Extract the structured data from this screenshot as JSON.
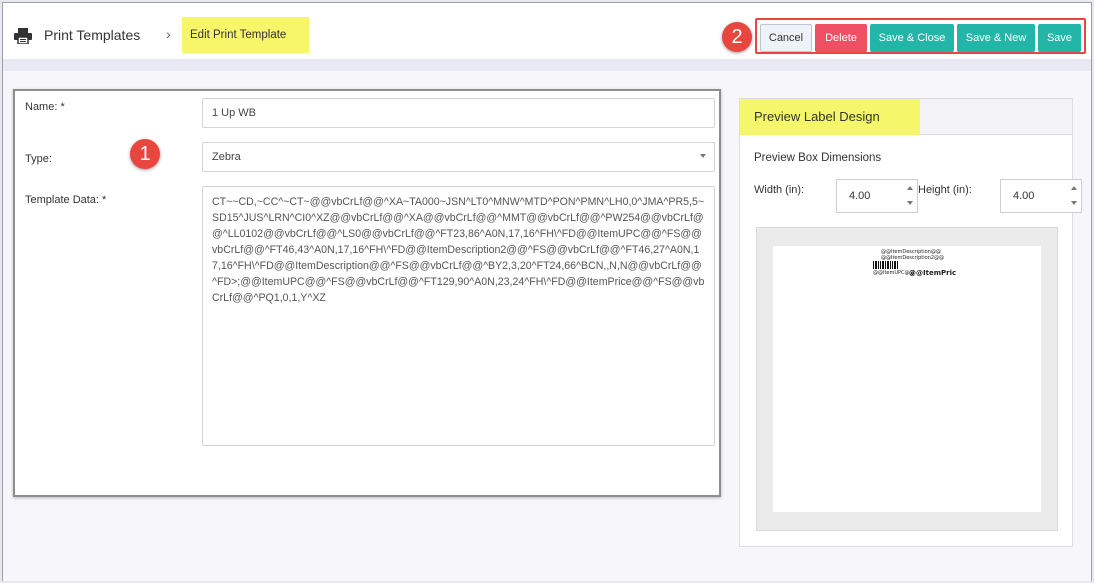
{
  "header": {
    "page_title": "Print Templates",
    "breadcrumb_current": "Edit Print Template",
    "icon": "printer-icon"
  },
  "callouts": {
    "one": "1",
    "two": "2"
  },
  "actions": {
    "cancel": "Cancel",
    "delete": "Delete",
    "save_close": "Save & Close",
    "save_new": "Save & New",
    "save": "Save"
  },
  "colors": {
    "teal": "#22b5a8",
    "delete_red": "#ef4f63",
    "callout_red": "#e8463e",
    "highlight_yellow": "#f7f56a"
  },
  "form": {
    "name_label": "Name: *",
    "name_value": "1 Up WB",
    "type_label": "Type:",
    "type_value": "Zebra",
    "template_label": "Template Data: *",
    "template_value": "CT~~CD,~CC^~CT~@@vbCrLf@@^XA~TA000~JSN^LT0^MNW^MTD^PON^PMN^LH0,0^JMA^PR5,5~SD15^JUS^LRN^CI0^XZ@@vbCrLf@@^XA@@vbCrLf@@^MMT@@vbCrLf@@^PW254@@vbCrLf@@^LL0102@@vbCrLf@@^LS0@@vbCrLf@@^FT23,86^A0N,17,16^FH\\^FD@@ItemUPC@@^FS@@vbCrLf@@^FT46,43^A0N,17,16^FH\\^FD@@ItemDescription2@@^FS@@vbCrLf@@^FT46,27^A0N,17,16^FH\\^FD@@ItemDescription@@^FS@@vbCrLf@@^BY2,3,20^FT24,66^BCN,,N,N@@vbCrLf@@^FD>;@@ItemUPC@@^FS@@vbCrLf@@^FT129,90^A0N,23,24^FH\\^FD@@ItemPrice@@^FS@@vbCrLf@@^PQ1,0,1,Y^XZ"
  },
  "preview": {
    "title": "Preview Label Design",
    "dims_title": "Preview Box Dimensions",
    "width_label": "Width (in):",
    "width_value": "4.00",
    "height_label": "Height (in):",
    "height_value": "4.00",
    "label_lines": {
      "desc1": "@@ItemDescription@@",
      "desc2": "@@ItemDescription2@@",
      "upc": "@@ItemUPC@@",
      "price": "@@ItemPric"
    }
  }
}
